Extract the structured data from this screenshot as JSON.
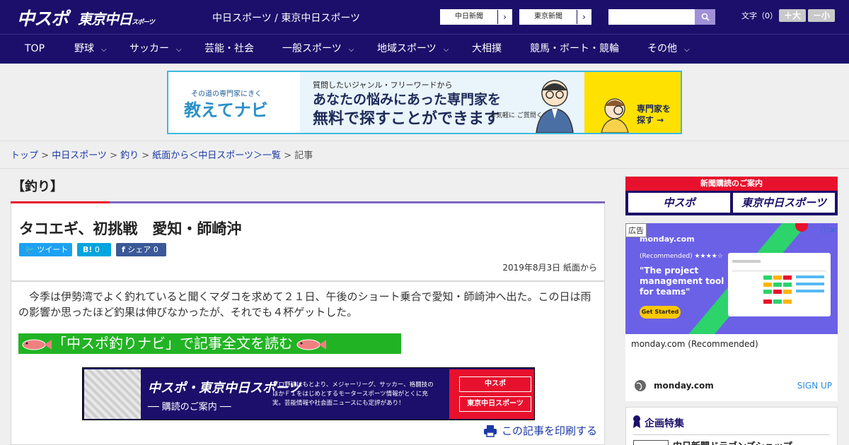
{
  "header": {
    "logo_chuspo": "中スポ",
    "logo_tokyo": "東京中日",
    "logo_tokyo_sub": "スポーツ",
    "site_title": "中日スポーツ / 東京中日スポーツ",
    "links": [
      "中日新聞",
      "東京新聞"
    ],
    "moji_label": "文字（0）",
    "size_up": "＋大",
    "size_down": "－小"
  },
  "nav": [
    {
      "label": "TOP",
      "has_menu": false
    },
    {
      "label": "野球",
      "has_menu": true
    },
    {
      "label": "サッカー",
      "has_menu": true
    },
    {
      "label": "芸能・社会",
      "has_menu": false
    },
    {
      "label": "一般スポーツ",
      "has_menu": true
    },
    {
      "label": "地域スポーツ",
      "has_menu": true
    },
    {
      "label": "大相撲",
      "has_menu": false
    },
    {
      "label": "競馬・ボート・競輪",
      "has_menu": false
    },
    {
      "label": "その他",
      "has_menu": true
    }
  ],
  "banner": {
    "small": "その道の専門家にきく",
    "logo": "教えてナビ",
    "line1": "質問したいジャンル・フリーワードから",
    "line2": "あなたの悩みにあった専門家を",
    "line3": "無料で探すことができます",
    "note": "お気軽に ご質問ください！",
    "cta": "専門家を 探す →"
  },
  "breadcrumb": [
    {
      "label": "トップ",
      "link": true
    },
    {
      "label": "中日スポーツ",
      "link": true
    },
    {
      "label": "釣り",
      "link": true
    },
    {
      "label": "紙面から＜中日スポーツ＞一覧",
      "link": true
    },
    {
      "label": "記事",
      "link": false
    }
  ],
  "article": {
    "category": "【釣り】",
    "title": "タコエギ、初挑戦　愛知・師崎沖",
    "share_tweet": "ツイート",
    "share_hatena": "0",
    "share_fb": "シェア 0",
    "date": "2019年8月3日 紙面から",
    "lead": "今季は伊勢湾でよく釣れていると聞くマダコを求めて２１日、午後のショート乗合で愛知・師崎沖へ出た。この日は雨の影響か思ったほど釣果は伸びなかったが、それでも４杯ゲットした。",
    "fishnavi": "「中スポ釣りナビ」で記事全文を読む",
    "subscribe_title": "中スポ・東京中日スポーツ",
    "subscribe_guide": "── 購読のご案内 ──",
    "subscribe_desc": "プロ野球はもとより、メジャーリーグ、サッカー、格闘技のほかＦ１をはじめとするモータースポーツ情報がとくに充実。芸能情報や社会面ニュースにも定評があり！",
    "subscribe_btns": [
      "中スポ",
      "東京中日スポーツ"
    ],
    "print": "この記事を印刷する"
  },
  "sidebar": {
    "sub_title": "新聞購読のご案内",
    "sub_boxes": [
      "中スポ",
      "東京中日スポーツ"
    ],
    "ad_label": "広告",
    "ad_brand": "monday.com",
    "ad_rec": "(Recommended) ★★★★☆",
    "ad_head": "\"The project management tool for teams\"",
    "ad_cta": "Get Started",
    "ad_caption": "monday.com (Recommended)",
    "ad_foot": "monday.com",
    "ad_signup": "SIGN UP",
    "kikaku_title": "企画特集",
    "kikaku_item": "中日新聞ドラゴンズショップ"
  },
  "colors": {
    "header_bg": "#1b0f6b",
    "accent_red": "#e8112d",
    "fishnavi_green": "#22b324"
  }
}
